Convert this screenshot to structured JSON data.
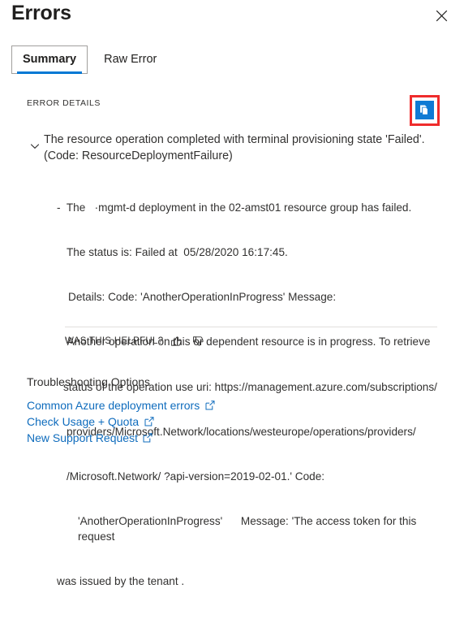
{
  "panel": {
    "title": "Errors",
    "close_icon": "close-icon"
  },
  "tabs": [
    {
      "label": "Summary",
      "selected": true
    },
    {
      "label": "Raw Error",
      "selected": false
    }
  ],
  "error_details": {
    "section_label": "ERROR DETAILS",
    "copy_button": {
      "icon": "copy-icon",
      "highlight_color": "#ef2c2c",
      "button_color": "#0f7ad4"
    },
    "expand_icon": "chevron-down-icon",
    "summary": "The resource operation completed with terminal provisioning state 'Failed'. (Code: ResourceDeploymentFailure)",
    "detail_lines": [
      "-  The   ·mgmt-d deployment in the 02-amst01 resource group has failed.",
      "The status is: Failed at  05/28/2020 16:17:45.",
      "Details: Code: 'AnotherOperationInProgress' Message:",
      "'Another operation on this or dependent resource is in progress. To retrieve",
      "status of the operation use uri: https://management.azure.com/subscriptions/",
      "providers/Microsoft.Network/locations/westeurope/operations/providers/",
      "/Microsoft.Network/ ?api-version=2019-02-01.' Code:",
      "'AnotherOperationInProgress'      Message: 'The access token for this request",
      "was issued by the tenant ."
    ]
  },
  "feedback": {
    "label": "WAS THIS HELPFUL?",
    "thumbs_up_icon": "thumbs-up-icon",
    "thumbs_down_icon": "thumbs-down-icon"
  },
  "troubleshooting": {
    "title": "Troubleshooting Options",
    "links": [
      {
        "label": "Common Azure deployment errors",
        "icon": "external-link-icon"
      },
      {
        "label": "Check Usage + Quota",
        "icon": "external-link-icon"
      },
      {
        "label": "New Support Request",
        "icon": "external-link-icon"
      }
    ],
    "link_color": "#0f6cbd"
  }
}
